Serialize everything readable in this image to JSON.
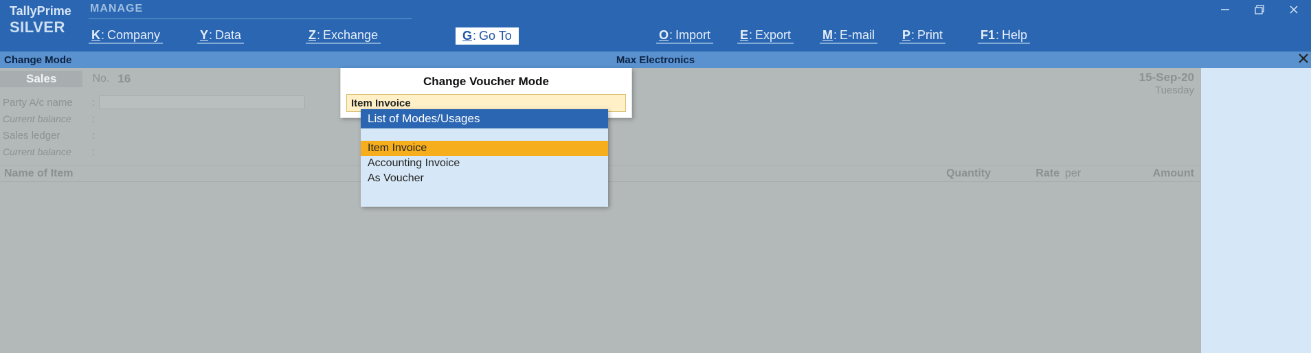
{
  "app": {
    "name": "TallyPrime",
    "edition": "SILVER",
    "manage_label": "MANAGE"
  },
  "menu": {
    "company": {
      "key": "K",
      "label": "Company"
    },
    "data": {
      "key": "Y",
      "label": "Data"
    },
    "exchange": {
      "key": "Z",
      "label": "Exchange"
    },
    "goto": {
      "key": "G",
      "label": "Go To"
    },
    "import": {
      "key": "O",
      "label": "Import"
    },
    "export": {
      "key": "E",
      "label": "Export"
    },
    "email": {
      "key": "M",
      "label": "E-mail"
    },
    "print": {
      "key": "P",
      "label": "Print"
    },
    "help": {
      "key": "F1",
      "label": "Help"
    }
  },
  "subbar": {
    "mode": "Change Mode",
    "company": "Max Electronics"
  },
  "voucher": {
    "type": "Sales",
    "no_label": "No.",
    "no_value": "16",
    "date": "15-Sep-20",
    "day": "Tuesday"
  },
  "fields": {
    "party_label": "Party A/c name",
    "current_balance_label": "Current balance",
    "sales_ledger_label": "Sales ledger"
  },
  "grid": {
    "item": "Name of Item",
    "qty": "Quantity",
    "rate": "Rate",
    "per": "per",
    "amount": "Amount"
  },
  "popup": {
    "title": "Change Voucher Mode",
    "input_value": "Item Invoice",
    "list_header": "List of Modes/Usages",
    "items": [
      "Item Invoice",
      "Accounting Invoice",
      "As Voucher"
    ],
    "selected_index": 0
  }
}
